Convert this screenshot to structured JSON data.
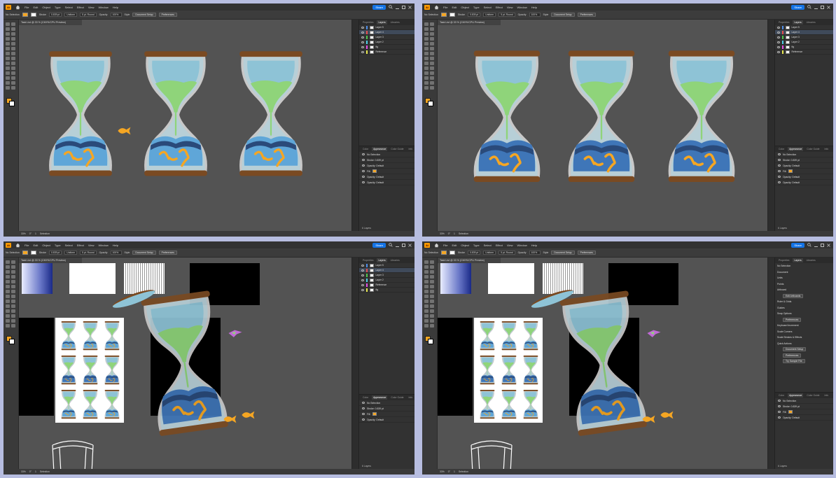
{
  "menu": {
    "logo": "Ai",
    "items": [
      "File",
      "Edit",
      "Object",
      "Type",
      "Select",
      "Effect",
      "View",
      "Window",
      "Help"
    ],
    "share": "Share"
  },
  "panes": [
    {
      "selection": "No Selection",
      "stroke_label": "Stroke",
      "stroke_value": "0.839 pt",
      "uniform": "Uniform",
      "brush": "5 pt. Round",
      "opacity_label": "Opacity",
      "opacity_value": "100%",
      "style_label": "Style",
      "doc_setup": "Document Setup",
      "preferences": "Preferences",
      "doc_tab": "Task List @ 33 % (CMYK/CPU Preview)",
      "zoom": "33%",
      "angle": "0°",
      "artboard_num": "1",
      "tool_name": "Selection",
      "layers_tabs": [
        "Properties",
        "Layers",
        "Libraries"
      ],
      "layers": [
        "Layer 5",
        "Layer 4",
        "Layer 3",
        "Layer 2",
        "fig",
        "Reference"
      ],
      "appearance_tabs": [
        "Color",
        "Appearance",
        "Color Guide",
        "Info"
      ],
      "appearance_rows": [
        "No Selection",
        "Stroke: 0.839 pt",
        "Opacity: Default",
        "Fill:",
        "Opacity: Default",
        "Opacity: Default"
      ],
      "layers_count": "6 Layers"
    },
    {
      "selection": "No Selection",
      "stroke_label": "Stroke",
      "stroke_value": "0.839 pt",
      "uniform": "Uniform",
      "brush": "5 pt. Round",
      "opacity_label": "Opacity",
      "opacity_value": "100%",
      "style_label": "Style",
      "doc_setup": "Document Setup",
      "preferences": "Preferences",
      "doc_tab": "Task List @ 33 % (CMYK/CPU Preview)",
      "zoom": "33%",
      "angle": "0°",
      "artboard_num": "1",
      "tool_name": "Selection",
      "layers_tabs": [
        "Properties",
        "Layers",
        "Libraries"
      ],
      "layers": [
        "Layer 5",
        "Layer 4",
        "Layer 3",
        "Layer 2",
        "fig",
        "Reference"
      ],
      "appearance_tabs": [
        "Color",
        "Appearance",
        "Color Guide",
        "Info"
      ],
      "appearance_rows": [
        "No Selection",
        "Stroke: 0.839 pt",
        "Opacity: Default",
        "Fill:",
        "Opacity: Default",
        "Opacity: Default"
      ],
      "layers_count": "6 Layers"
    },
    {
      "selection": "No Selection",
      "stroke_label": "Stroke",
      "stroke_value": "0.839 pt",
      "uniform": "Uniform",
      "brush": "5 pt. Round",
      "opacity_label": "Opacity",
      "opacity_value": "100%",
      "style_label": "Style",
      "doc_setup": "Document Setup",
      "preferences": "Preferences",
      "doc_tab": "Task List @ 33 % (CMYK/CPU Preview)",
      "zoom": "33%",
      "angle": "0°",
      "artboard_num": "1",
      "tool_name": "Selection",
      "layers_tabs": [
        "Properties",
        "Layers",
        "Libraries"
      ],
      "layers": [
        "Layer 5",
        "Layer 4",
        "Layer 3",
        "Layer 2",
        "Reference",
        "fig"
      ],
      "appearance_tabs": [
        "Color",
        "Appearance",
        "Color Guide",
        "Info"
      ],
      "appearance_rows": [
        "No Selection",
        "Stroke: 0.839 pt",
        "Fill:",
        "Opacity: Default"
      ],
      "layers_count": "6 Layers"
    },
    {
      "selection": "No Selection",
      "stroke_label": "Stroke",
      "stroke_value": "0.839 pt",
      "uniform": "Uniform",
      "brush": "5 pt. Round",
      "opacity_label": "Opacity",
      "opacity_value": "100%",
      "style_label": "Style",
      "doc_setup": "Document Setup",
      "preferences": "Preferences",
      "doc_tab": "Task List @ 33 % (CMYK/CPU Preview)",
      "zoom": "33%",
      "angle": "0°",
      "artboard_num": "1",
      "tool_name": "Selection",
      "layers_tabs": [
        "Properties",
        "Layers",
        "Libraries"
      ],
      "properties": [
        "No Selection",
        "Document",
        "Units",
        "Points",
        "Artboard",
        "Edit Artboards",
        "Ruler & Grids",
        "Guides",
        "Snap Options",
        "Preferences",
        "Keyboard Increment",
        "Scale Corners",
        "Scale Strokes & Effects",
        "Quick Actions",
        "Document Setup",
        "Preferences",
        "Try Sample File"
      ],
      "appearance_tabs": [
        "Color",
        "Appearance",
        "Color Guide",
        "Info"
      ],
      "appearance_rows": [
        "No Selection",
        "Stroke: 0.839 pt",
        "Fill:",
        "Opacity: Default"
      ],
      "layers_count": "6 Layers"
    }
  ],
  "colors": {
    "app_bg": "#535353",
    "glass": "#a9c9d4",
    "sand": "#8fd47a",
    "water": "#4b86c5",
    "fish": "#f5a623",
    "wood": "#7a4a22",
    "accent": "#1473e6"
  },
  "icons": [
    "home-icon",
    "search-icon",
    "minimize-icon",
    "maximize-icon",
    "close-icon",
    "eye-icon",
    "fish-icon",
    "bird-icon",
    "chair-icon"
  ]
}
